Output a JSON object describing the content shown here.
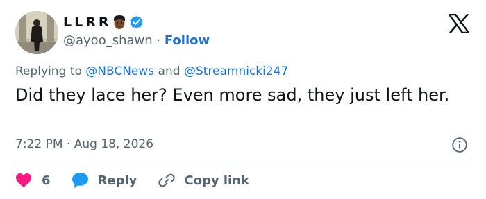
{
  "user": {
    "display_name": "LLRR",
    "handle": "@ayoo_shawn",
    "separator": "·",
    "follow_label": "Follow"
  },
  "reply_context": {
    "prefix": "Replying to",
    "mention_1": "@NBCNews",
    "conjunction": "and",
    "mention_2": "@Streamnicki247"
  },
  "tweet": {
    "text": "Did they lace her? Even more sad, they just left her.",
    "time": "7:22 PM",
    "separator": "·",
    "date": "Aug 18, 2026"
  },
  "actions": {
    "like_count": "6",
    "reply_label": "Reply",
    "copy_label": "Copy link"
  },
  "icons": {
    "verified": "verified-badge-icon",
    "emoji": "face-emoji-icon",
    "logo": "x-logo-icon",
    "info": "info-icon",
    "like": "heart-icon",
    "reply": "speech-bubble-icon",
    "copy": "link-icon"
  },
  "colors": {
    "accent": "#1d9bf0",
    "link": "#1d72d0",
    "like": "#f91880",
    "text": "#0f1419",
    "muted": "#536471",
    "divider": "#cfd9de"
  }
}
